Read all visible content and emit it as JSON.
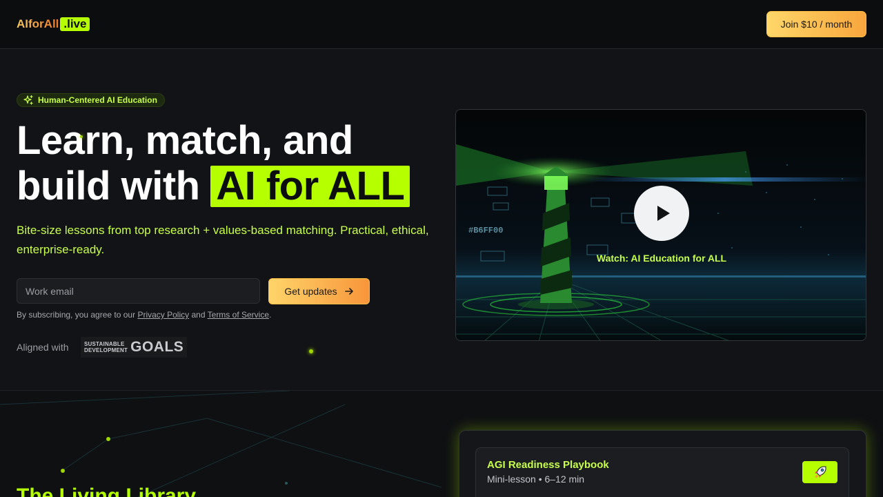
{
  "header": {
    "logo_main": "AIforAll",
    "logo_tld": ".live",
    "join_label": "Join $10 / month"
  },
  "hero": {
    "badge": "Human-Centered AI Education",
    "headline_line1": "Learn, match, and",
    "headline_line2_prefix": "build with",
    "headline_accent": "AI for ALL",
    "subtitle": "Bite-size lessons from top research + values-based matching. Practical, ethical, enterprise-ready.",
    "email_placeholder": "Work email",
    "updates_label": "Get updates",
    "legal_prefix": "By subscribing, you agree to our",
    "privacy_link": "Privacy Policy",
    "legal_and": "and",
    "terms_link": "Terms of Service",
    "legal_suffix": ".",
    "aligned_label": "Aligned with",
    "sdg_line1": "SUSTAINABLE",
    "sdg_line2": "DEVELOPMENT",
    "sdg_goals": "GOALS"
  },
  "video": {
    "caption": "Watch: AI Education for ALL",
    "hex_tag": "#B6FF00"
  },
  "library": {
    "title": "The Living Library",
    "item_title": "AGI Readiness Playbook",
    "item_meta": "Mini-lesson • 6–12 min"
  },
  "icons": {
    "badge_icon": "sparkles-icon",
    "updates_icon": "arrow-right-icon",
    "play_icon": "play-icon",
    "rocket_icon": "rocket-icon"
  },
  "colors": {
    "accent": "#b6ff00",
    "background": "#121316",
    "button_gradient_start": "#ffd76a",
    "button_gradient_end": "#f7963a"
  }
}
